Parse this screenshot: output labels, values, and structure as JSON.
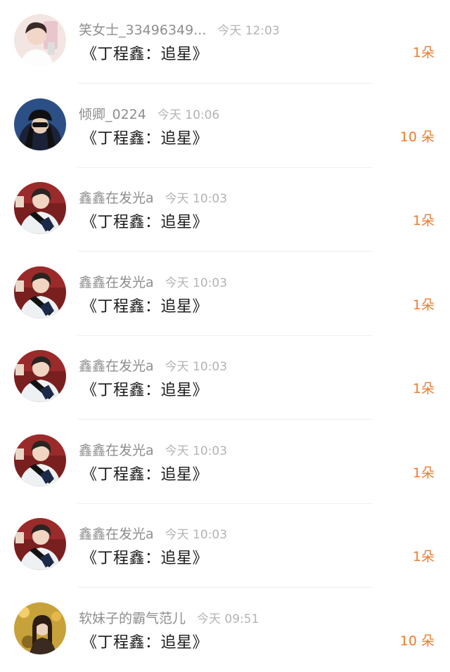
{
  "rows": [
    {
      "name": "笑女士_33496349...",
      "time": "今天 12:03",
      "title": "《丁程鑫：追星》",
      "count": "1朵",
      "avatar": "avatar-1"
    },
    {
      "name": "倾卿_0224",
      "time": "今天 10:06",
      "title": "《丁程鑫：追星》",
      "count": "10 朵",
      "avatar": "avatar-2"
    },
    {
      "name": "鑫鑫在发光a",
      "time": "今天 10:03",
      "title": "《丁程鑫：追星》",
      "count": "1朵",
      "avatar": "avatar-3"
    },
    {
      "name": "鑫鑫在发光a",
      "time": "今天 10:03",
      "title": "《丁程鑫：追星》",
      "count": "1朵",
      "avatar": "avatar-3"
    },
    {
      "name": "鑫鑫在发光a",
      "time": "今天 10:03",
      "title": "《丁程鑫：追星》",
      "count": "1朵",
      "avatar": "avatar-3"
    },
    {
      "name": "鑫鑫在发光a",
      "time": "今天 10:03",
      "title": "《丁程鑫：追星》",
      "count": "1朵",
      "avatar": "avatar-3"
    },
    {
      "name": "鑫鑫在发光a",
      "time": "今天 10:03",
      "title": "《丁程鑫：追星》",
      "count": "1朵",
      "avatar": "avatar-3"
    },
    {
      "name": "软妹子的霸气范儿",
      "time": "今天 09:51",
      "title": "《丁程鑫：追星》",
      "count": "10 朵",
      "avatar": "avatar-4"
    }
  ],
  "colors": {
    "accent": "#f07a2e",
    "name": "#8e8e8e",
    "time": "#b3b3b3",
    "title": "#1a1a1a",
    "divider": "#eeeeee"
  }
}
